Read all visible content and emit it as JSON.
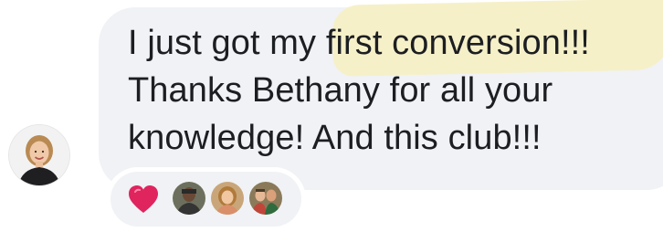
{
  "comment": {
    "lines": [
      "I just got my ",
      "first conversion!!!",
      "Thanks Bethany for all your",
      "knowledge! And this club!!!"
    ],
    "highlight_color": "#f6efc6",
    "bubble_color": "#f0f2f5",
    "text_color": "#1c1e21"
  },
  "avatar": {
    "icon": "user-avatar-photo"
  },
  "reactions": {
    "items": [
      {
        "icon": "heart-reaction-icon",
        "color": "#e0245e"
      },
      {
        "icon": "reactor-avatar-1"
      },
      {
        "icon": "reactor-avatar-2"
      },
      {
        "icon": "reactor-avatar-3"
      }
    ]
  }
}
